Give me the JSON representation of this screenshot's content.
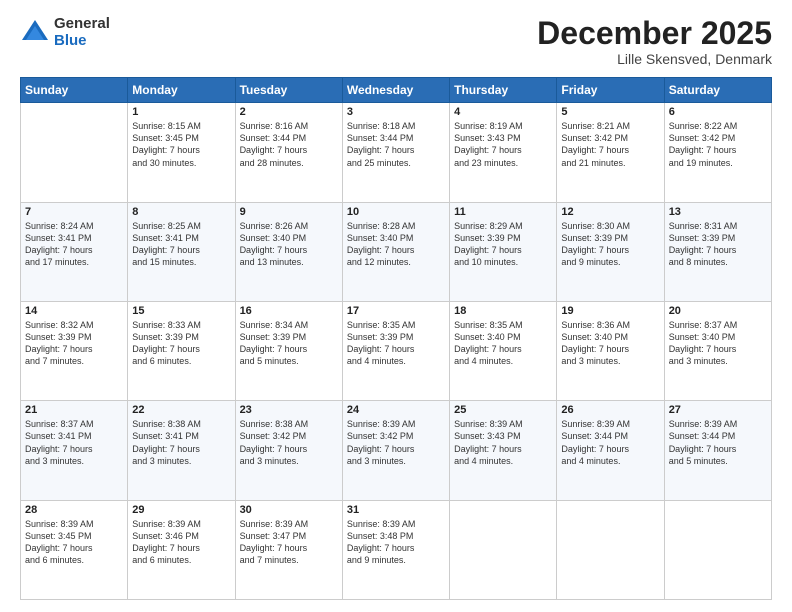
{
  "logo": {
    "general": "General",
    "blue": "Blue"
  },
  "title": "December 2025",
  "subtitle": "Lille Skensved, Denmark",
  "days_header": [
    "Sunday",
    "Monday",
    "Tuesday",
    "Wednesday",
    "Thursday",
    "Friday",
    "Saturday"
  ],
  "weeks": [
    [
      {
        "num": "",
        "info": ""
      },
      {
        "num": "1",
        "info": "Sunrise: 8:15 AM\nSunset: 3:45 PM\nDaylight: 7 hours\nand 30 minutes."
      },
      {
        "num": "2",
        "info": "Sunrise: 8:16 AM\nSunset: 3:44 PM\nDaylight: 7 hours\nand 28 minutes."
      },
      {
        "num": "3",
        "info": "Sunrise: 8:18 AM\nSunset: 3:44 PM\nDaylight: 7 hours\nand 25 minutes."
      },
      {
        "num": "4",
        "info": "Sunrise: 8:19 AM\nSunset: 3:43 PM\nDaylight: 7 hours\nand 23 minutes."
      },
      {
        "num": "5",
        "info": "Sunrise: 8:21 AM\nSunset: 3:42 PM\nDaylight: 7 hours\nand 21 minutes."
      },
      {
        "num": "6",
        "info": "Sunrise: 8:22 AM\nSunset: 3:42 PM\nDaylight: 7 hours\nand 19 minutes."
      }
    ],
    [
      {
        "num": "7",
        "info": "Sunrise: 8:24 AM\nSunset: 3:41 PM\nDaylight: 7 hours\nand 17 minutes."
      },
      {
        "num": "8",
        "info": "Sunrise: 8:25 AM\nSunset: 3:41 PM\nDaylight: 7 hours\nand 15 minutes."
      },
      {
        "num": "9",
        "info": "Sunrise: 8:26 AM\nSunset: 3:40 PM\nDaylight: 7 hours\nand 13 minutes."
      },
      {
        "num": "10",
        "info": "Sunrise: 8:28 AM\nSunset: 3:40 PM\nDaylight: 7 hours\nand 12 minutes."
      },
      {
        "num": "11",
        "info": "Sunrise: 8:29 AM\nSunset: 3:39 PM\nDaylight: 7 hours\nand 10 minutes."
      },
      {
        "num": "12",
        "info": "Sunrise: 8:30 AM\nSunset: 3:39 PM\nDaylight: 7 hours\nand 9 minutes."
      },
      {
        "num": "13",
        "info": "Sunrise: 8:31 AM\nSunset: 3:39 PM\nDaylight: 7 hours\nand 8 minutes."
      }
    ],
    [
      {
        "num": "14",
        "info": "Sunrise: 8:32 AM\nSunset: 3:39 PM\nDaylight: 7 hours\nand 7 minutes."
      },
      {
        "num": "15",
        "info": "Sunrise: 8:33 AM\nSunset: 3:39 PM\nDaylight: 7 hours\nand 6 minutes."
      },
      {
        "num": "16",
        "info": "Sunrise: 8:34 AM\nSunset: 3:39 PM\nDaylight: 7 hours\nand 5 minutes."
      },
      {
        "num": "17",
        "info": "Sunrise: 8:35 AM\nSunset: 3:39 PM\nDaylight: 7 hours\nand 4 minutes."
      },
      {
        "num": "18",
        "info": "Sunrise: 8:35 AM\nSunset: 3:40 PM\nDaylight: 7 hours\nand 4 minutes."
      },
      {
        "num": "19",
        "info": "Sunrise: 8:36 AM\nSunset: 3:40 PM\nDaylight: 7 hours\nand 3 minutes."
      },
      {
        "num": "20",
        "info": "Sunrise: 8:37 AM\nSunset: 3:40 PM\nDaylight: 7 hours\nand 3 minutes."
      }
    ],
    [
      {
        "num": "21",
        "info": "Sunrise: 8:37 AM\nSunset: 3:41 PM\nDaylight: 7 hours\nand 3 minutes."
      },
      {
        "num": "22",
        "info": "Sunrise: 8:38 AM\nSunset: 3:41 PM\nDaylight: 7 hours\nand 3 minutes."
      },
      {
        "num": "23",
        "info": "Sunrise: 8:38 AM\nSunset: 3:42 PM\nDaylight: 7 hours\nand 3 minutes."
      },
      {
        "num": "24",
        "info": "Sunrise: 8:39 AM\nSunset: 3:42 PM\nDaylight: 7 hours\nand 3 minutes."
      },
      {
        "num": "25",
        "info": "Sunrise: 8:39 AM\nSunset: 3:43 PM\nDaylight: 7 hours\nand 4 minutes."
      },
      {
        "num": "26",
        "info": "Sunrise: 8:39 AM\nSunset: 3:44 PM\nDaylight: 7 hours\nand 4 minutes."
      },
      {
        "num": "27",
        "info": "Sunrise: 8:39 AM\nSunset: 3:44 PM\nDaylight: 7 hours\nand 5 minutes."
      }
    ],
    [
      {
        "num": "28",
        "info": "Sunrise: 8:39 AM\nSunset: 3:45 PM\nDaylight: 7 hours\nand 6 minutes."
      },
      {
        "num": "29",
        "info": "Sunrise: 8:39 AM\nSunset: 3:46 PM\nDaylight: 7 hours\nand 6 minutes."
      },
      {
        "num": "30",
        "info": "Sunrise: 8:39 AM\nSunset: 3:47 PM\nDaylight: 7 hours\nand 7 minutes."
      },
      {
        "num": "31",
        "info": "Sunrise: 8:39 AM\nSunset: 3:48 PM\nDaylight: 7 hours\nand 9 minutes."
      },
      {
        "num": "",
        "info": ""
      },
      {
        "num": "",
        "info": ""
      },
      {
        "num": "",
        "info": ""
      }
    ]
  ]
}
